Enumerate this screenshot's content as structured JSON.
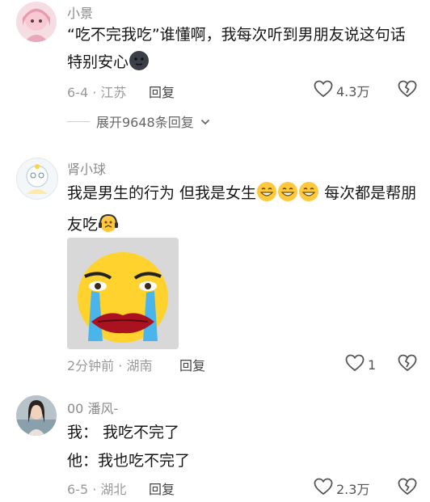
{
  "comments": [
    {
      "username": "小景",
      "text": "“吃不完我吃”谁懂啊，我每次听到男朋友说这句话特别安心",
      "date_location": "6-4 · 江苏",
      "reply_label": "回复",
      "like_count": "4.3万",
      "expand_label": "展开9648条回复"
    },
    {
      "username": "肾小球",
      "text_before": "我是男生的行为 但我是女生",
      "text_after": " 每次都是帮朋友吃",
      "date_location": "2分钟前 · 湖南",
      "reply_label": "回复",
      "like_count": "1"
    },
    {
      "username": "00 潘风-",
      "lines": [
        "我： 我吃不完了",
        "他：我也吃不完了"
      ],
      "date_location": "6-5 · 湖北",
      "reply_label": "回复",
      "like_count": "2.3万"
    }
  ],
  "icons": {
    "like": "heart-outline-icon",
    "dislike": "broken-heart-icon",
    "expand": "chevron-down-icon",
    "emoji_smile": "grinning-face-emoji",
    "emoji_dark": "dark-moon-face-emoji",
    "emoji_gasp": "headphones-face-emoji"
  },
  "colors": {
    "text": "#161616",
    "meta": "#999999",
    "username": "#8a8a8a"
  }
}
